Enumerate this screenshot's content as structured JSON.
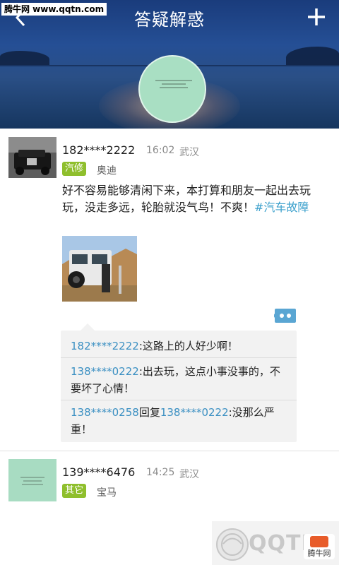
{
  "header": {
    "title": "答疑解惑",
    "back_icon": "back-arrow-icon",
    "add_icon": "plus-icon"
  },
  "watermark_top": "腾牛网 www.qqtn.com",
  "posts": [
    {
      "username": "182****2222",
      "time": "16:02",
      "location": "武汉",
      "tag": "汽修",
      "car": "奥迪",
      "body_text": "好不容易能够清闲下来，本打算和朋友一起出去玩玩，没走多远，轮胎就没气鸟！不爽！",
      "hashtag": "#汽车故障",
      "comments": [
        {
          "user": "182****2222",
          "text": ":这路上的人好少啊！"
        },
        {
          "user": "138****0222",
          "text": ":出去玩，这点小事没事的，不要坏了心情！"
        },
        {
          "user": "138****0258",
          "reply_word": "回复",
          "reply_to": "138****0222",
          "text": ":没那么严重！"
        }
      ]
    },
    {
      "username": "139****6476",
      "time": "14:25",
      "location": "武汉",
      "tag": "其它",
      "car": "宝马"
    }
  ],
  "watermark_bottom": {
    "text": "QQTN",
    "badge": "腾牛网"
  },
  "colors": {
    "accent_blue": "#3a8fc2",
    "tag_green": "#8fbf2d",
    "comment_bg": "#f2f2f2"
  }
}
